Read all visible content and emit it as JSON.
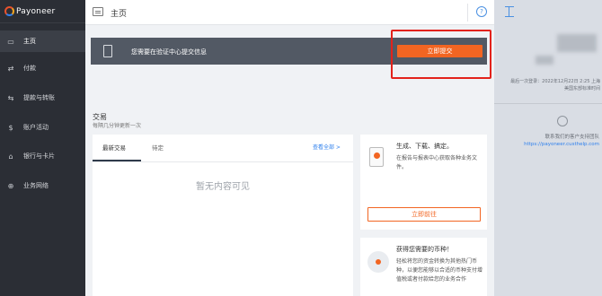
{
  "app": {
    "logo_text": "Payoneer"
  },
  "sidebar": {
    "items": [
      {
        "label": "主页",
        "icon": "home-icon",
        "active": true
      },
      {
        "label": "付款",
        "icon": "payments-icon"
      },
      {
        "label": "提款与转账",
        "icon": "withdraw-icon"
      },
      {
        "label": "账户活动",
        "icon": "activity-icon"
      },
      {
        "label": "银行与卡片",
        "icon": "bank-card-icon"
      },
      {
        "label": "业务网络",
        "icon": "network-icon"
      }
    ]
  },
  "header": {
    "title": "主页",
    "help_icon": "help-icon"
  },
  "alert": {
    "text": "您需要在验证中心提交信息",
    "button_label": "立即提交"
  },
  "transactions": {
    "title": "交易",
    "subtitle": "每隔几分钟更新一次",
    "tabs": [
      "最新交易",
      "待定"
    ],
    "view_all": "查看全部 >",
    "empty_text": "暂无内容可见"
  },
  "cards": {
    "reports": {
      "title": "生成、下载、搞定。",
      "desc": "在报告与报表中心获取各种业务文件。",
      "button_label": "立即前往"
    },
    "currency": {
      "title": "获得您需要的币种！",
      "desc": "轻松将您的资金转换为其他热门币种，以便您能够以合适的币种支付增值税或者付款给您的业务合作"
    }
  },
  "right_panel": {
    "login_text": "最后一次登录：2022年12月22日 2:25 上海 美国东部标准时间",
    "contact_text": "联系我们的客户支持团队",
    "contact_link": "https://payoneer.custhelp.com"
  },
  "colors": {
    "accent": "#f26522",
    "sidebar": "#2b2e35",
    "alert_bg": "#525964",
    "highlight": "#e3221b"
  }
}
